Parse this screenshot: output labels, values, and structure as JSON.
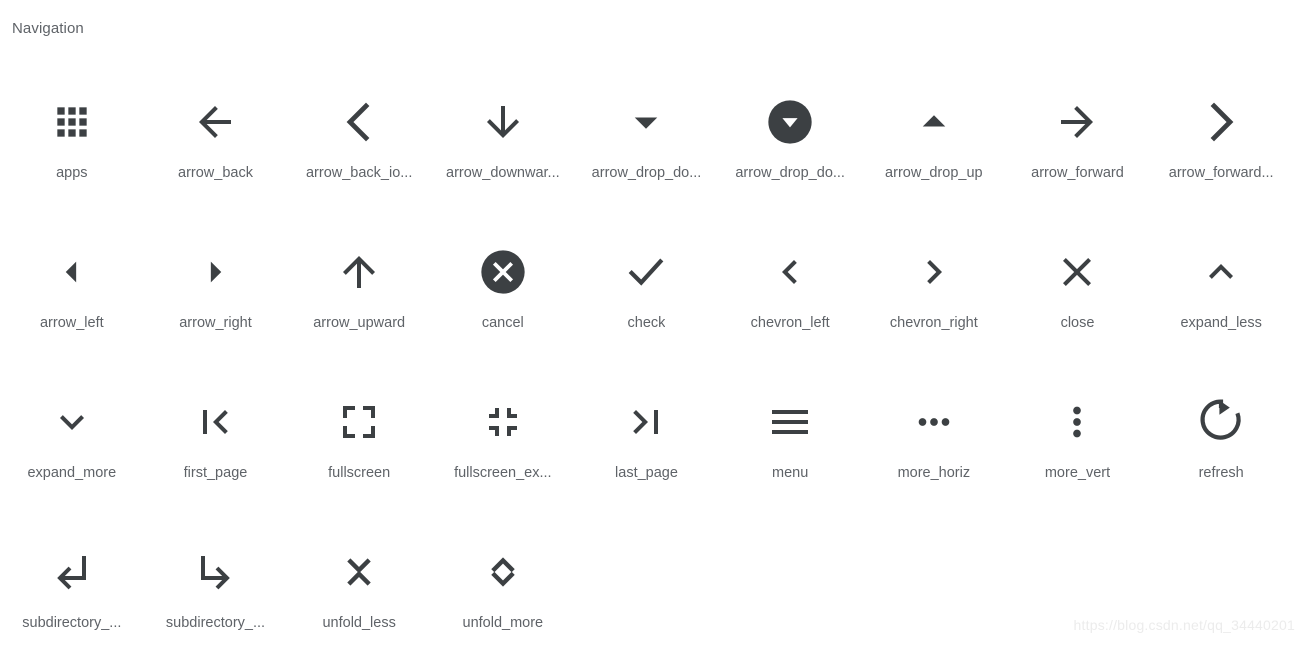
{
  "section": {
    "title": "Navigation"
  },
  "colors": {
    "icon": "#3c4043",
    "label": "#5f6368",
    "background": "#ffffff",
    "watermark": "#ececec"
  },
  "watermark": {
    "text": "https://blog.csdn.net/qq_34440201"
  },
  "icons": [
    {
      "label": "apps",
      "name": "apps-icon",
      "glyph": "apps"
    },
    {
      "label": "arrow_back",
      "name": "arrow-back-icon",
      "glyph": "arrow_back"
    },
    {
      "label": "arrow_back_io...",
      "name": "arrow-back-ios-icon",
      "glyph": "arrow_back_ios"
    },
    {
      "label": "arrow_downwar...",
      "name": "arrow-downward-icon",
      "glyph": "arrow_downward"
    },
    {
      "label": "arrow_drop_do...",
      "name": "arrow-drop-down-icon",
      "glyph": "arrow_drop_down"
    },
    {
      "label": "arrow_drop_do...",
      "name": "arrow-drop-down-circle-icon",
      "glyph": "arrow_drop_down_circle"
    },
    {
      "label": "arrow_drop_up",
      "name": "arrow-drop-up-icon",
      "glyph": "arrow_drop_up"
    },
    {
      "label": "arrow_forward",
      "name": "arrow-forward-icon",
      "glyph": "arrow_forward"
    },
    {
      "label": "arrow_forward...",
      "name": "arrow-forward-ios-icon",
      "glyph": "arrow_forward_ios"
    },
    {
      "label": "arrow_left",
      "name": "arrow-left-icon",
      "glyph": "arrow_left"
    },
    {
      "label": "arrow_right",
      "name": "arrow-right-icon",
      "glyph": "arrow_right"
    },
    {
      "label": "arrow_upward",
      "name": "arrow-upward-icon",
      "glyph": "arrow_upward"
    },
    {
      "label": "cancel",
      "name": "cancel-icon",
      "glyph": "cancel"
    },
    {
      "label": "check",
      "name": "check-icon",
      "glyph": "check"
    },
    {
      "label": "chevron_left",
      "name": "chevron-left-icon",
      "glyph": "chevron_left"
    },
    {
      "label": "chevron_right",
      "name": "chevron-right-icon",
      "glyph": "chevron_right"
    },
    {
      "label": "close",
      "name": "close-icon",
      "glyph": "close"
    },
    {
      "label": "expand_less",
      "name": "expand-less-icon",
      "glyph": "expand_less"
    },
    {
      "label": "expand_more",
      "name": "expand-more-icon",
      "glyph": "expand_more"
    },
    {
      "label": "first_page",
      "name": "first-page-icon",
      "glyph": "first_page"
    },
    {
      "label": "fullscreen",
      "name": "fullscreen-icon",
      "glyph": "fullscreen"
    },
    {
      "label": "fullscreen_ex...",
      "name": "fullscreen-exit-icon",
      "glyph": "fullscreen_exit"
    },
    {
      "label": "last_page",
      "name": "last-page-icon",
      "glyph": "last_page"
    },
    {
      "label": "menu",
      "name": "menu-icon",
      "glyph": "menu"
    },
    {
      "label": "more_horiz",
      "name": "more-horiz-icon",
      "glyph": "more_horiz"
    },
    {
      "label": "more_vert",
      "name": "more-vert-icon",
      "glyph": "more_vert"
    },
    {
      "label": "refresh",
      "name": "refresh-icon",
      "glyph": "refresh"
    },
    {
      "label": "subdirectory_...",
      "name": "subdirectory-arrow-left-icon",
      "glyph": "subdirectory_arrow_left"
    },
    {
      "label": "subdirectory_...",
      "name": "subdirectory-arrow-right-icon",
      "glyph": "subdirectory_arrow_right"
    },
    {
      "label": "unfold_less",
      "name": "unfold-less-icon",
      "glyph": "unfold_less"
    },
    {
      "label": "unfold_more",
      "name": "unfold-more-icon",
      "glyph": "unfold_more"
    }
  ]
}
